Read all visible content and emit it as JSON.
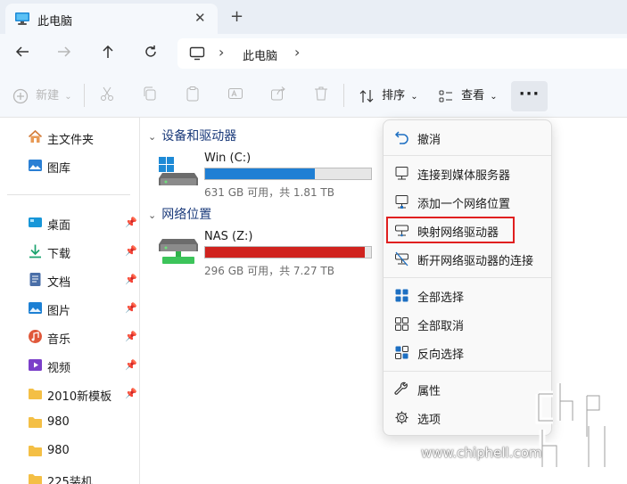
{
  "tab": {
    "title": "此电脑",
    "close": "✕",
    "add": "+"
  },
  "address": {
    "location": "此电脑"
  },
  "commands": {
    "new_label": "新建",
    "sort_label": "排序",
    "view_label": "查看",
    "more_label": "···"
  },
  "sidebar": {
    "items": [
      {
        "label": "主文件夹",
        "icon": "home-icon"
      },
      {
        "label": "图库",
        "icon": "gallery-icon"
      },
      {
        "label": "桌面",
        "icon": "desktop-icon",
        "pinned": true
      },
      {
        "label": "下载",
        "icon": "download-icon",
        "pinned": true
      },
      {
        "label": "文档",
        "icon": "document-icon",
        "pinned": true
      },
      {
        "label": "图片",
        "icon": "pictures-icon",
        "pinned": true
      },
      {
        "label": "音乐",
        "icon": "music-icon",
        "pinned": true
      },
      {
        "label": "视频",
        "icon": "video-icon",
        "pinned": true
      },
      {
        "label": "2010新模板",
        "icon": "folder-icon",
        "pinned": true
      },
      {
        "label": "980",
        "icon": "folder-icon",
        "pinned": false
      },
      {
        "label": "980",
        "icon": "folder-icon",
        "pinned": false
      },
      {
        "label": "225装机",
        "icon": "folder-icon",
        "pinned": false
      }
    ]
  },
  "main": {
    "devices_header": "设备和驱动器",
    "network_header": "网络位置",
    "drives": [
      {
        "name": "Win (C:)",
        "detail": "631 GB 可用，共 1.81 TB",
        "used_fraction": 0.66,
        "bar_color": "#1f7fd4"
      },
      {
        "name": "NAS (Z:)",
        "detail": "296 GB 可用，共 7.27 TB",
        "used_fraction": 0.96,
        "bar_color": "#d0231e"
      }
    ]
  },
  "menu": {
    "items": [
      {
        "label": "撤消",
        "icon": "undo-icon"
      },
      {
        "label": "连接到媒体服务器",
        "icon": "media-server-icon"
      },
      {
        "label": "添加一个网络位置",
        "icon": "network-location-icon"
      },
      {
        "label": "映射网络驱动器",
        "icon": "map-drive-icon",
        "highlighted": true
      },
      {
        "label": "断开网络驱动器的连接",
        "icon": "disconnect-drive-icon"
      },
      {
        "label": "全部选择",
        "icon": "select-all-icon"
      },
      {
        "label": "全部取消",
        "icon": "select-none-icon"
      },
      {
        "label": "反向选择",
        "icon": "invert-selection-icon"
      },
      {
        "label": "属性",
        "icon": "properties-icon"
      },
      {
        "label": "选项",
        "icon": "options-icon"
      }
    ]
  },
  "watermark": {
    "site": "www.chiphell.com"
  }
}
